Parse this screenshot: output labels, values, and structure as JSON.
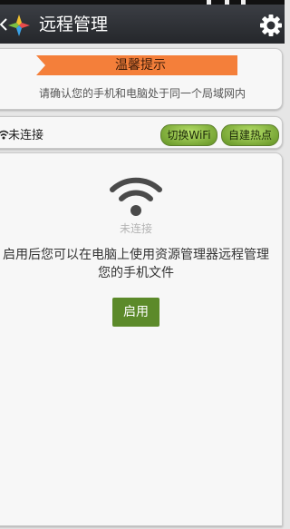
{
  "header": {
    "title": "远程管理",
    "icons": [
      "back-icon",
      "app-logo-icon",
      "gear-icon"
    ]
  },
  "tip_card": {
    "banner": "温馨提示",
    "message": "请确认您的手机和电脑处于同一个局域网内"
  },
  "connection_bar": {
    "status": "未连接",
    "switch_wifi_label": "切换WiFi",
    "hotspot_label": "自建热点"
  },
  "main_panel": {
    "status": "未连接",
    "description": "启用后您可以在电脑上使用资源管理器远程管理您的手机文件",
    "enable_label": "启用"
  },
  "colors": {
    "titlebar": "#2e3035",
    "ribbon": "#f47f3a",
    "pill_green": "#8cc040",
    "enable_button": "#5c8a2a",
    "wifi_icon": "#4a4a4a"
  }
}
